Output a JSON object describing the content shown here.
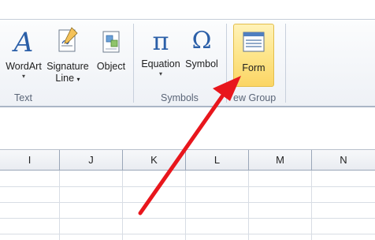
{
  "ribbon": {
    "groups": [
      {
        "name": "Text",
        "buttons": [
          {
            "label": "WordArt",
            "dropdown": true
          },
          {
            "label_line1": "Signature",
            "label_line2": "Line",
            "dropdown": true
          },
          {
            "label": "Object",
            "dropdown": false
          }
        ]
      },
      {
        "name": "Symbols",
        "buttons": [
          {
            "label": "Equation",
            "dropdown": true,
            "glyph": "π"
          },
          {
            "label": "Symbol",
            "dropdown": false,
            "glyph": "Ω"
          }
        ]
      },
      {
        "name": "New Group",
        "visible_name": "ew Group",
        "buttons": [
          {
            "label": "Form",
            "highlighted": true
          }
        ]
      }
    ],
    "dropdown_arrow": "▾"
  },
  "columns": [
    "I",
    "J",
    "K",
    "L",
    "M",
    "N"
  ],
  "icons": {
    "wordart": "wordart-icon",
    "signature": "signature-line-icon",
    "object": "object-icon",
    "equation": "pi-icon",
    "symbol": "omega-icon",
    "form": "form-icon",
    "annotation": "red-arrow-annotation"
  },
  "colors": {
    "highlight_fill": "#fde58a",
    "highlight_border": "#e3be4a",
    "glyph_blue": "#2b5fa8",
    "arrow_red": "#e8161c"
  }
}
